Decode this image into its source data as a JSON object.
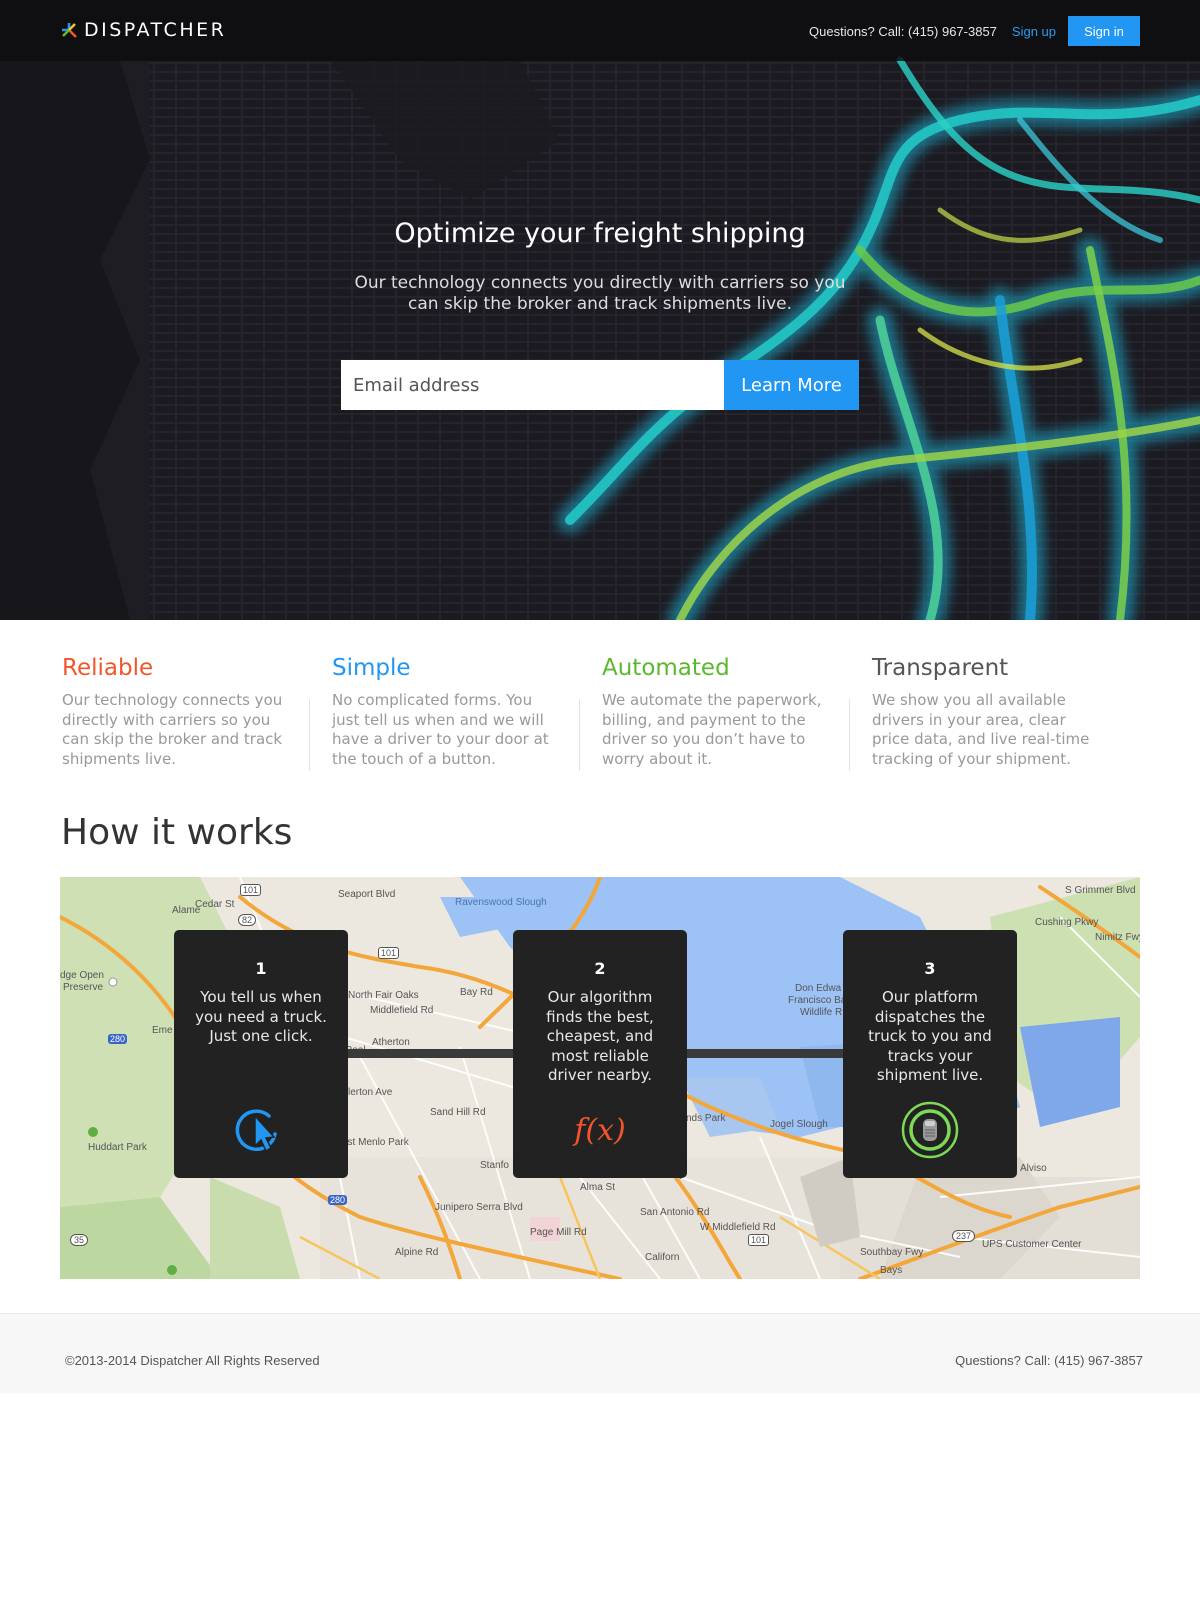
{
  "header": {
    "logo_text": "DISPATCHER",
    "phone_text": "Questions?  Call: (415) 967-3857",
    "signup_label": "Sign up",
    "signin_label": "Sign in"
  },
  "hero": {
    "title": "Optimize your freight shipping",
    "subtitle": "Our technology connects you directly with carriers so you can skip the broker and track shipments live.",
    "email_placeholder": "Email address",
    "cta_label": "Learn More"
  },
  "features": [
    {
      "title": "Reliable",
      "color": "#f2552c",
      "text": "Our technology connects you directly with carriers so you can skip the broker and track shipments live."
    },
    {
      "title": "Simple",
      "color": "#2196f3",
      "text": "No complicated forms. You just tell us when and we will have a driver to your door at the touch of a button."
    },
    {
      "title": "Automated",
      "color": "#5cb82e",
      "text": "We automate the paperwork, billing, and payment to the driver so you don’t have to worry about it."
    },
    {
      "title": "Transparent",
      "color": "#555555",
      "text": "We show you all available drivers in your area, clear price data, and live real-time tracking of your shipment."
    }
  ],
  "how": {
    "title": "How it works",
    "steps": [
      {
        "number": "1",
        "text": "You tell us when you need a truck. Just one click.",
        "icon": "cursor-click-icon"
      },
      {
        "number": "2",
        "text": "Our algorithm finds the best, cheapest, and most reliable driver nearby.",
        "icon": "function-icon",
        "icon_text": "f(x)"
      },
      {
        "number": "3",
        "text": "Our platform dispatches the truck to you and tracks your shipment live.",
        "icon": "truck-tracking-icon"
      }
    ],
    "map_labels": {
      "ravenswood": "Ravenswood Slough",
      "north_fair_oaks": "North Fair Oaks",
      "atherton": "Atherton",
      "menlo_park": "est Menlo Park",
      "huddart": "Huddart Park",
      "edge_open": "dge Open",
      "preserve": "Preserve",
      "don_edwards": "Don Edwa",
      "francisco_bay": "Francisco Ba",
      "wildlife": "Wildlife R",
      "jogel": "Jogel Slough",
      "nds_park": "nds Park",
      "alviso": "Alviso",
      "ups": "UPS Customer Center",
      "stanford": "Stanfo",
      "southbay": "Southbay Fwy",
      "alma": "Alma St",
      "page_mill": "Page Mill Rd",
      "junipero": "Junipero Serra Blvd",
      "sand_hill": "Sand Hill Rd",
      "bay_rd": "Bay Rd",
      "middlefield": "Middlefield Rd",
      "w_middlefield": "W Middlefield Rd",
      "san_antonio": "San Antonio Rd",
      "cushing": "Cushing Pkwy",
      "grimmer": "S Grimmer Blvd",
      "nimitz": "Nimitz Fwy",
      "seaport": "Seaport Blvd",
      "cedar": "Cedar St",
      "alameda": "Alame",
      "emerald": "Eme",
      "real": "Real",
      "california": "Californ",
      "fwy": "wy",
      "bayst": "Bays",
      "lherton": "lerton Ave",
      "alpine": "Alpine Rd",
      "shield_101a": "101",
      "shield_101b": "101",
      "shield_101c": "101",
      "shield_82": "82",
      "shield_280a": "280",
      "shield_280b": "280",
      "shield_35": "35",
      "shield_237": "237"
    }
  },
  "footer": {
    "copyright": "©2013-2014 Dispatcher All Rights Reserved",
    "phone_text": "Questions?  Call: (415) 967-3857"
  }
}
